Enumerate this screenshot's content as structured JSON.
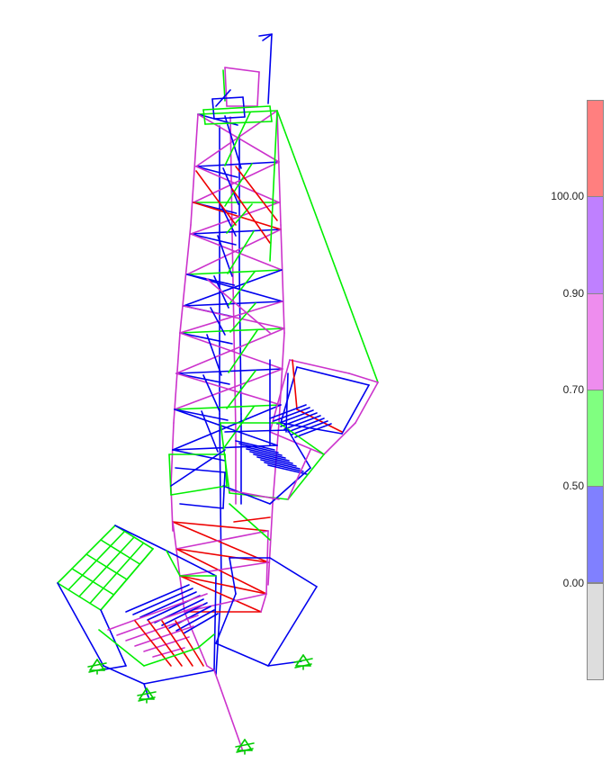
{
  "legend": {
    "bands": [
      {
        "color": "#ff7f7f",
        "label": ""
      },
      {
        "color": "#bf80ff",
        "label": "100.00"
      },
      {
        "color": "#ee8dee",
        "label": "0.90"
      },
      {
        "color": "#80ff80",
        "label": "0.70"
      },
      {
        "color": "#8080ff",
        "label": "0.50"
      },
      {
        "color": "#dddddd",
        "label": "0.00"
      }
    ]
  },
  "colors": {
    "blue": "#0000ee",
    "green": "#00ee00",
    "magenta": "#cc33cc",
    "red": "#ee0000",
    "support": "#00cc00"
  },
  "model": {
    "description_icon": "structural-frame-model",
    "support_icon": "fixed-support-icon"
  }
}
